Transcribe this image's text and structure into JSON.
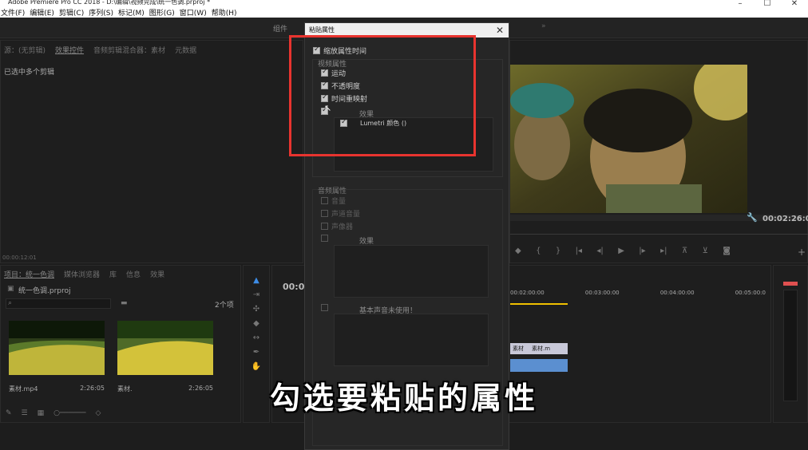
{
  "window": {
    "title": "Adobe Premiere Pro CC 2018 - D:\\编辑\\视频完成\\统一色调.prproj *",
    "min": "–",
    "max": "☐",
    "close": "✕"
  },
  "menu": [
    "文件(F)",
    "编辑(E)",
    "剪辑(C)",
    "序列(S)",
    "标记(M)",
    "图形(G)",
    "窗口(W)",
    "帮助(H)"
  ],
  "workspace": {
    "tab": "组件",
    "more": "»"
  },
  "left_panel": {
    "tabs": [
      "源：(无剪辑)",
      "效果控件",
      "音频剪辑混合器：素材",
      "元数据"
    ],
    "status": "已选中多个剪辑",
    "timecode": "00:00:12:01"
  },
  "project_panel": {
    "tabs": [
      "项目：统一色调",
      "媒体浏览器",
      "库",
      "信息",
      "效果"
    ],
    "project_file": "统一色调.prproj",
    "item_count": "2个项",
    "items": [
      {
        "name": "素材.mp4",
        "duration": "2:26:05"
      },
      {
        "name": "素材.",
        "duration": "2:26:05"
      }
    ]
  },
  "program_monitor": {
    "timecode": "00:02:26:05"
  },
  "timeline": {
    "timecode": "00:00",
    "ruler": [
      "00:02:00:00",
      "00:03:00:00",
      "00:04:00:00",
      "00:05:00:0"
    ],
    "clips": [
      "素材",
      "素材.m"
    ]
  },
  "dialog": {
    "title": "粘贴属性",
    "close": "✕",
    "scale_time": "缩放属性时间",
    "video_section": "视频属性",
    "video_items": [
      "运动",
      "不透明度",
      "时间重映射"
    ],
    "effects_label": "效果",
    "effects_list": [
      "Lumetri 颜色 ()"
    ],
    "audio_section": "音频属性",
    "audio_items": [
      "音量",
      "声道音量",
      "声像器"
    ],
    "audio_effects_label": "效果",
    "basic_sound": "基本声音未使用！"
  },
  "subtitle": "勾选要粘贴的属性",
  "colors": {
    "highlight": "#e8342f",
    "timeline_accent": "#f0c000",
    "clip_audio": "#5b8fd0"
  }
}
